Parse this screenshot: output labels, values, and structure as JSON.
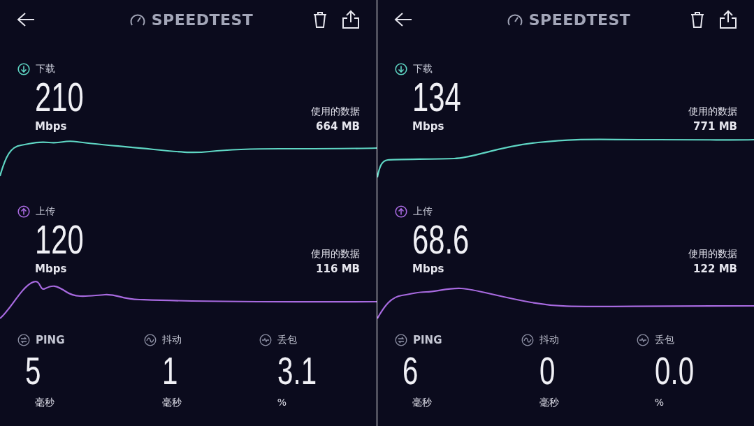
{
  "screens": [
    {
      "title": "SPEEDTEST",
      "download": {
        "label": "下载",
        "value": "210",
        "unit": "Mbps",
        "data_label": "使用的数据",
        "data_value": "664 MB"
      },
      "upload": {
        "label": "上传",
        "value": "120",
        "unit": "Mbps",
        "data_label": "使用的数据",
        "data_value": "116 MB"
      },
      "stats": [
        {
          "kind": "ping",
          "label": "PING",
          "value": "5",
          "unit": "毫秒"
        },
        {
          "kind": "jitter",
          "label": "抖动",
          "value": "1",
          "unit": "毫秒"
        },
        {
          "kind": "loss",
          "label": "丢包",
          "value": "3.1",
          "unit": "%"
        }
      ]
    },
    {
      "title": "SPEEDTEST",
      "download": {
        "label": "下载",
        "value": "134",
        "unit": "Mbps",
        "data_label": "使用的数据",
        "data_value": "771 MB"
      },
      "upload": {
        "label": "上传",
        "value": "68.6",
        "unit": "Mbps",
        "data_label": "使用的数据",
        "data_value": "122 MB"
      },
      "stats": [
        {
          "kind": "ping",
          "label": "PING",
          "value": "6",
          "unit": "毫秒"
        },
        {
          "kind": "jitter",
          "label": "抖动",
          "value": "0",
          "unit": "毫秒"
        },
        {
          "kind": "loss",
          "label": "丢包",
          "value": "0.0",
          "unit": "%"
        }
      ]
    }
  ]
}
